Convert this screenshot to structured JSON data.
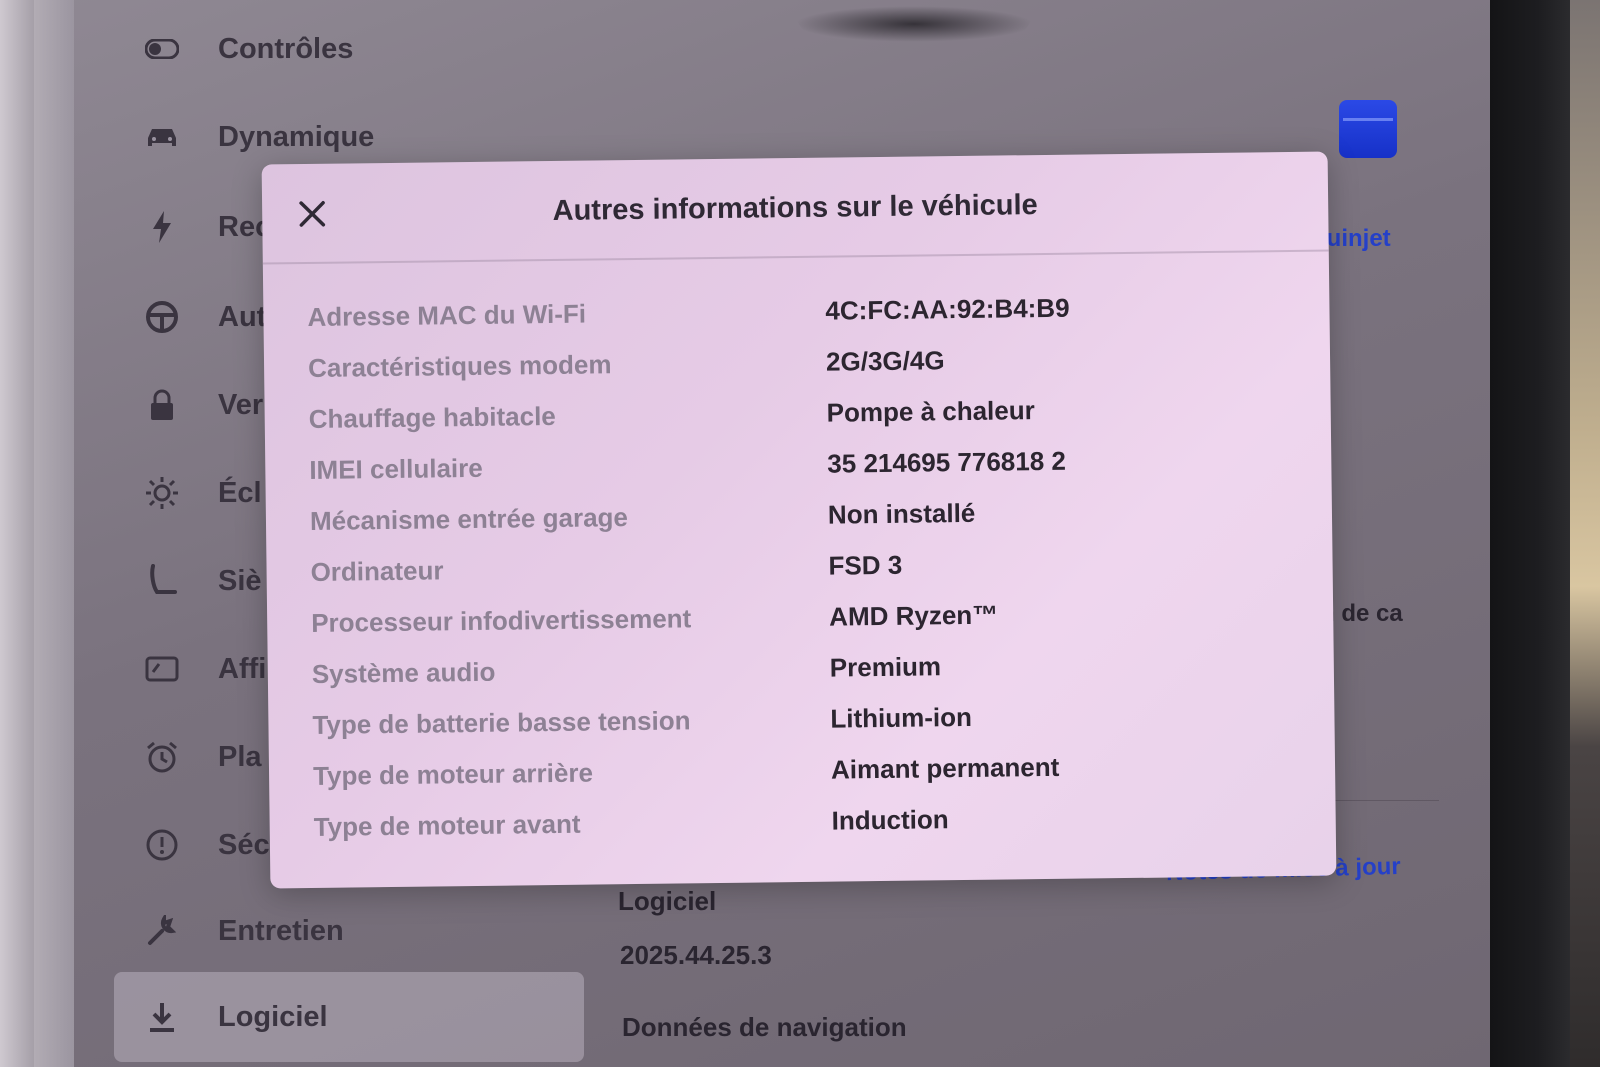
{
  "menu": {
    "items": [
      {
        "label": "Contrôles",
        "icon": "toggle-icon"
      },
      {
        "label": "Dynamique",
        "icon": "car-icon"
      },
      {
        "label": "Rec",
        "icon": "lightning-icon"
      },
      {
        "label": "Aut",
        "icon": "steering-wheel-icon"
      },
      {
        "label": "Ver",
        "icon": "lock-icon"
      },
      {
        "label": "Écl",
        "icon": "sun-icon"
      },
      {
        "label": "Siè",
        "icon": "seat-icon"
      },
      {
        "label": "Affi",
        "icon": "display-icon"
      },
      {
        "label": "Pla",
        "icon": "alarm-clock-icon"
      },
      {
        "label": "Séc",
        "icon": "alert-circle-icon"
      },
      {
        "label": "Entretien",
        "icon": "wrench-icon"
      },
      {
        "label": "Logiciel",
        "icon": "download-icon"
      }
    ],
    "active_index": 11
  },
  "background": {
    "profile_link": "Quinjet",
    "truncated_text": "ien de ca",
    "release_notes_link": "Notes de mise à jour",
    "software_label": "Logiciel",
    "software_version": "2025.44.25.3",
    "nav_data_label": "Données de navigation"
  },
  "dialog": {
    "title": "Autres informations sur le véhicule",
    "rows": [
      {
        "label": "Adresse MAC du Wi-Fi",
        "value": "4C:FC:AA:92:B4:B9"
      },
      {
        "label": "Caractéristiques modem",
        "value": "2G/3G/4G"
      },
      {
        "label": "Chauffage habitacle",
        "value": "Pompe à chaleur"
      },
      {
        "label": "IMEI cellulaire",
        "value": "35 214695 776818 2"
      },
      {
        "label": "Mécanisme entrée garage",
        "value": "Non installé"
      },
      {
        "label": "Ordinateur",
        "value": "FSD 3"
      },
      {
        "label": "Processeur infodivertissement",
        "value": "AMD Ryzen™"
      },
      {
        "label": "Système audio",
        "value": "Premium"
      },
      {
        "label": "Type de batterie basse tension",
        "value": "Lithium-ion"
      },
      {
        "label": "Type de moteur arrière",
        "value": "Aimant permanent"
      },
      {
        "label": "Type de moteur avant",
        "value": "Induction"
      }
    ]
  },
  "colors": {
    "accent_blue": "#2540c8",
    "dialog_bg": "#e6cbe6",
    "label_gray": "#8d8194",
    "value_dark": "#2c2530"
  }
}
